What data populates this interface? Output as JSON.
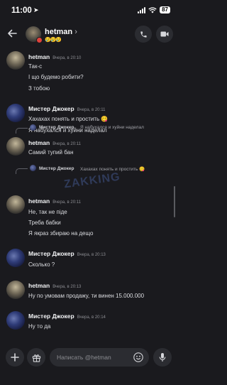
{
  "status": {
    "time": "11:00",
    "battery": "87"
  },
  "header": {
    "name": "hetman",
    "chevron": "›",
    "emoji": "😢😢😢"
  },
  "messages": [
    {
      "author": "hetman",
      "time": "Вчера, в 20:10",
      "lines": [
        "Так-с",
        "І що будемо робити?",
        "З тобою"
      ]
    },
    {
      "author": "Мистер Джокер",
      "time": "Вчера, в 20:11",
      "lines": [
        "Хахахах понять и простить 😋",
        "Я набухался и хуйни наделал"
      ]
    },
    {
      "reply_author": "Мистер Джокер",
      "reply_text": "Я набухался и хуйни наделал",
      "author": "hetman",
      "time": "Вчера, в 20:11",
      "lines": [
        "Самий тупий бан"
      ]
    },
    {
      "reply_author": "Мистер Джокер",
      "reply_text": "Хахахах понять и простить 😋",
      "author": "hetman",
      "time": "Вчера, в 20:11",
      "lines": [
        "Не, так не піде",
        "Треба бабки",
        "Я якраз збираю на дещо"
      ]
    },
    {
      "author": "Мистер Джокер",
      "time": "Вчера, в 20:13",
      "lines": [
        "Сколько ?"
      ]
    },
    {
      "author": "hetman",
      "time": "Вчера, в 20:13",
      "lines": [
        "Ну по умовам продажу, ти винен 15.000.000"
      ]
    },
    {
      "author": "Мистер Джокер",
      "time": "Вчера, в 20:14",
      "lines": [
        "Ну то да"
      ]
    }
  ],
  "watermark": "ZAKKING",
  "composer": {
    "placeholder": "Написать @hetman"
  },
  "icons": {
    "back": "back-arrow-icon",
    "call": "phone-icon",
    "video": "video-camera-icon",
    "add": "plus-icon",
    "gift": "gift-icon",
    "emoji": "smiley-icon",
    "mic": "microphone-icon"
  },
  "colors": {
    "background": "#1a1a1e",
    "surface": "#2b2c31",
    "text": "#dcdde1",
    "muted": "#8c8d92"
  }
}
